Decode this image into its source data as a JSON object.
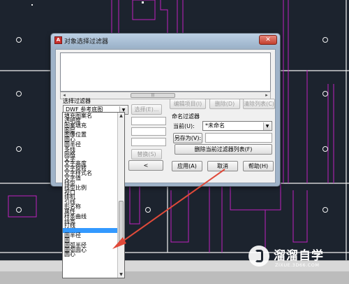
{
  "dialog": {
    "title": "对象选择过滤器",
    "close_label": "✕",
    "select_filter_label": "选择过滤器",
    "filter_combo_value": "DWF 参考底图",
    "select_button": "选择(E)...",
    "edit_item_button": "编辑项目(I)",
    "delete_button": "删除(D)",
    "clear_list_button": "清除列表(C)",
    "substitute_button": "替换(S)",
    "left_arrow_button": "<",
    "named_filters_label": "命名过滤器",
    "current_label": "当前(U):",
    "current_value": "*未命名",
    "save_as_button": "另存为(V):",
    "save_as_value": "",
    "delete_current_filter_button": "删除当前过滤器列表(F)",
    "apply_button": "应用(A)",
    "cancel_button": "取消",
    "help_button": "帮助(H)"
  },
  "dropdown_items": [
    "填充图案名",
    "透明度",
    "图案填充",
    "图层",
    "图像位置",
    "圆心",
    "圆半径",
    "多线",
    "网格",
    "文字",
    "文字高度",
    "文字旋转",
    "文字样式名",
    "文字值",
    "线型",
    "线型比例",
    "视口",
    "排机",
    "引线",
    "形名称",
    "属性",
    "样条曲线",
    "线宽",
    "打线",
    "",
    "圆半径",
    "圆",
    "圆弧半径",
    "圆弧圆心",
    "圆心"
  ],
  "selected_index": 24,
  "watermark": {
    "title": "溜溜自学",
    "url": "ZIXUE.3D66.COM"
  },
  "colors": {
    "cad_background": "#1c232e",
    "cad_line_magenta": "#c020c0",
    "cad_line_white": "#ffffff",
    "selection": "#3399ff",
    "arrow": "#e04a3a"
  },
  "icons": {
    "app_icon": "autocad-a-icon",
    "close": "close-icon",
    "combo_dropdown": "chevron-down-icon",
    "pointer_arrow": "arrow-icon"
  }
}
